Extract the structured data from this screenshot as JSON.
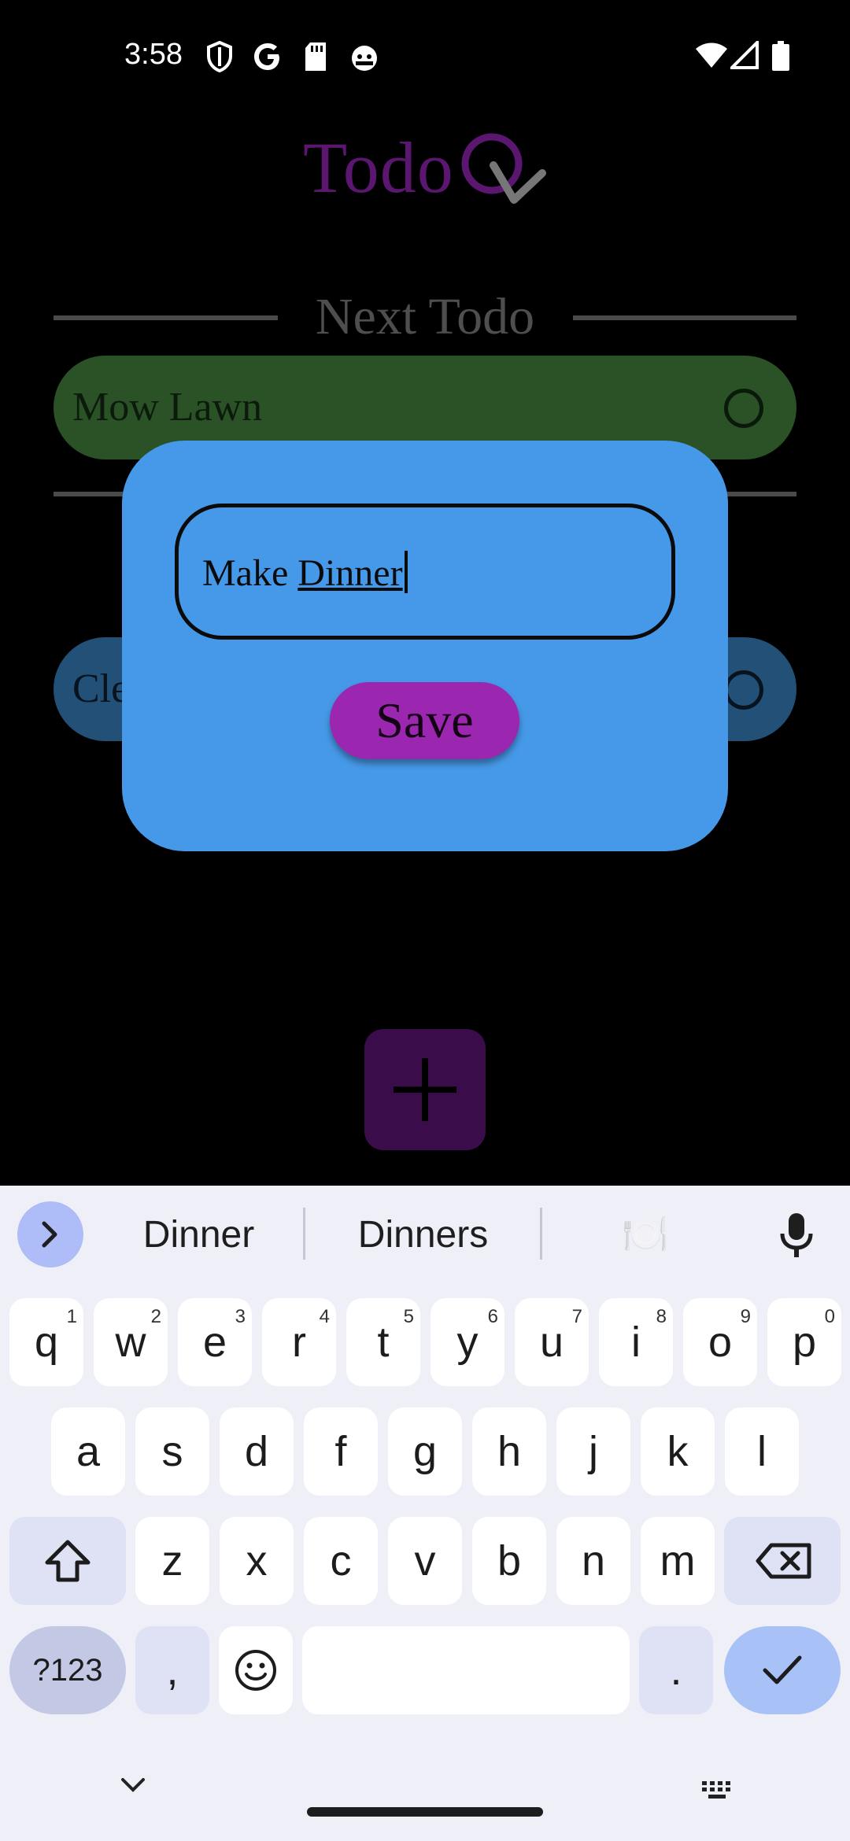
{
  "status_bar": {
    "time": "3:58",
    "left_icons": [
      "shield-icon",
      "google-icon",
      "sd-card-icon",
      "android-robot-icon"
    ],
    "right_icons": [
      "wifi-icon",
      "cell-signal-icon",
      "battery-icon"
    ]
  },
  "app": {
    "logo_text": "Todo",
    "logo_mark": "Q",
    "section_title": "Next Todo",
    "next_todo": {
      "label": "Mow Lawn"
    },
    "other_todo": {
      "label": "Cle"
    },
    "fab_icon": "plus-icon"
  },
  "dialog": {
    "input_value_prefix": "Make ",
    "input_value_word": "Dinner",
    "save_label": "Save"
  },
  "keyboard": {
    "suggestions": [
      "Dinner",
      "Dinners",
      "🍽️"
    ],
    "row1": [
      {
        "k": "q",
        "n": "1"
      },
      {
        "k": "w",
        "n": "2"
      },
      {
        "k": "e",
        "n": "3"
      },
      {
        "k": "r",
        "n": "4"
      },
      {
        "k": "t",
        "n": "5"
      },
      {
        "k": "y",
        "n": "6"
      },
      {
        "k": "u",
        "n": "7"
      },
      {
        "k": "i",
        "n": "8"
      },
      {
        "k": "o",
        "n": "9"
      },
      {
        "k": "p",
        "n": "0"
      }
    ],
    "row2": [
      "a",
      "s",
      "d",
      "f",
      "g",
      "h",
      "j",
      "k",
      "l"
    ],
    "row3": [
      "z",
      "x",
      "c",
      "v",
      "b",
      "n",
      "m"
    ],
    "num_label": "?123",
    "comma": ",",
    "period": "."
  },
  "colors": {
    "background": "#000000",
    "next_todo_bg": "#2b5227",
    "other_todo_bg": "#225077",
    "dialog_bg": "#4699e8",
    "save_button": "#9b27b0",
    "logo": "#5b1670",
    "fab": "#3a0c4a"
  }
}
